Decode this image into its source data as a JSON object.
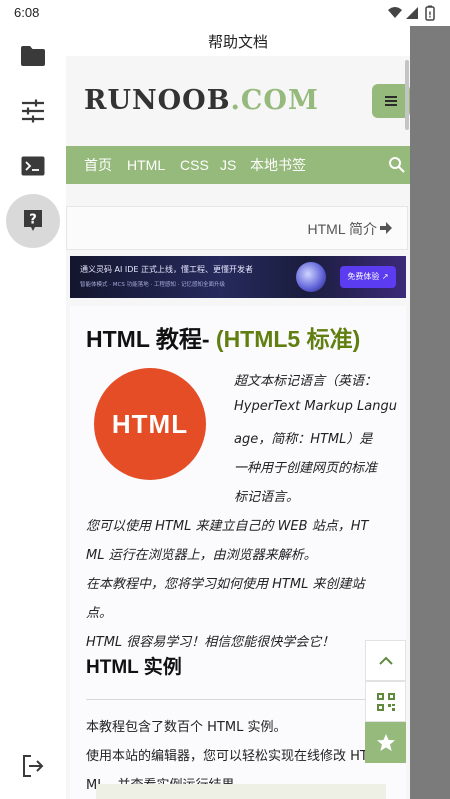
{
  "status_bar": {
    "time": "6:08"
  },
  "app": {
    "title": "帮助文档"
  },
  "rail": {
    "items": [
      {
        "icon": "folder-icon"
      },
      {
        "icon": "sliders-icon"
      },
      {
        "icon": "terminal-icon"
      },
      {
        "icon": "help-icon",
        "active": true
      },
      {
        "icon": "logout-icon"
      }
    ]
  },
  "site": {
    "logo_main": "RUNOOB",
    "logo_suffix": ".COM",
    "nav": [
      "首页",
      "HTML",
      "CSS",
      "JS",
      "本地书签"
    ],
    "next_link": "HTML 简介"
  },
  "banner": {
    "headline": "通义灵码 AI IDE 正式上线，懂工程、更懂开发者",
    "subline": "智能体模式 · MCS 功能落地 · 工程感知 · 记忆感知全面升级",
    "cta": "免费体验 ↗"
  },
  "article": {
    "title_main": "HTML 教程- ",
    "title_accent": "(HTML5 标准)",
    "logo_text": "HTML",
    "intro_lines": [
      "超文本标记语言（英语：",
      "HyperText Markup Langu",
      "age，简称：HTML）是",
      "一种用于创建网页的标准",
      "标记语言。"
    ],
    "body_lines": [
      "您可以使用 HTML 来建立自己的 WEB 站点，HT",
      "ML 运行在浏览器上，由浏览器来解析。",
      "在本教程中，您将学习如何使用 HTML 来创建站",
      "点。",
      "HTML 很容易学习！相信您能很快学会它！"
    ],
    "examples_heading": "HTML 实例",
    "examples_lines": [
      "本教程包含了数百个 HTML 实例。",
      "使用本站的编辑器，您可以轻松实现在线修改 HT",
      "ML，并查看实例运行结果。"
    ]
  },
  "floating": [
    {
      "icon": "chevron-up-icon"
    },
    {
      "icon": "qr-code-icon"
    },
    {
      "icon": "star-icon"
    }
  ],
  "colors": {
    "accent_green": "#96b97c",
    "title_green": "#617f10",
    "html_logo": "#e44d26",
    "scrim": "#7b7b7b"
  }
}
